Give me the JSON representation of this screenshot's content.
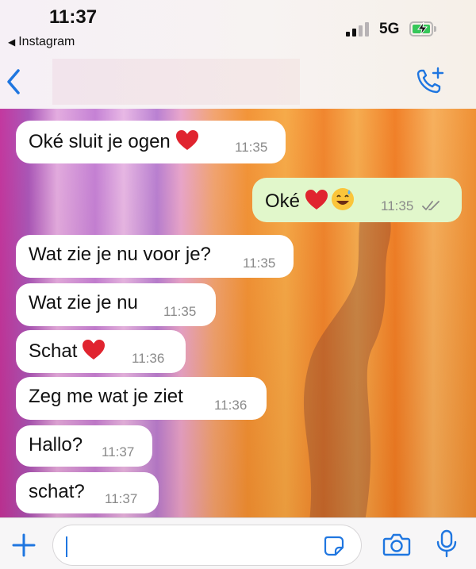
{
  "status_bar": {
    "time": "11:37",
    "back_app_label": "Instagram",
    "network": "5G"
  },
  "header": {
    "contact_name_blurred": true
  },
  "messages": [
    {
      "direction": "incoming",
      "text": "Oké sluit je ogen",
      "emoji": "heart",
      "time": "11:35"
    },
    {
      "direction": "outgoing",
      "text": "Oké",
      "emoji": "heart, sweat-smile",
      "time": "11:35",
      "status": "read"
    },
    {
      "direction": "incoming",
      "text": "Wat zie je nu voor je?",
      "time": "11:35"
    },
    {
      "direction": "incoming",
      "text": "Wat zie je nu",
      "time": "11:35"
    },
    {
      "direction": "incoming",
      "text": "Schat",
      "emoji": "heart",
      "time": "11:36"
    },
    {
      "direction": "incoming",
      "text": "Zeg me wat je ziet",
      "time": "11:36"
    },
    {
      "direction": "incoming",
      "text": "Hallo?",
      "time": "11:37"
    },
    {
      "direction": "incoming",
      "text": "schat?",
      "time": "11:37"
    }
  ],
  "composer": {
    "value": ""
  },
  "colors": {
    "accent": "#1f76e0",
    "incoming_bubble": "#ffffff",
    "outgoing_bubble": "#e1f7cb",
    "timestamp": "#8a8a8a"
  },
  "icons": [
    "back-chevron-icon",
    "call-add-icon",
    "plus-icon",
    "sticker-icon",
    "camera-icon",
    "microphone-icon",
    "heart-emoji",
    "sweat-smile-emoji",
    "double-check-icon"
  ]
}
